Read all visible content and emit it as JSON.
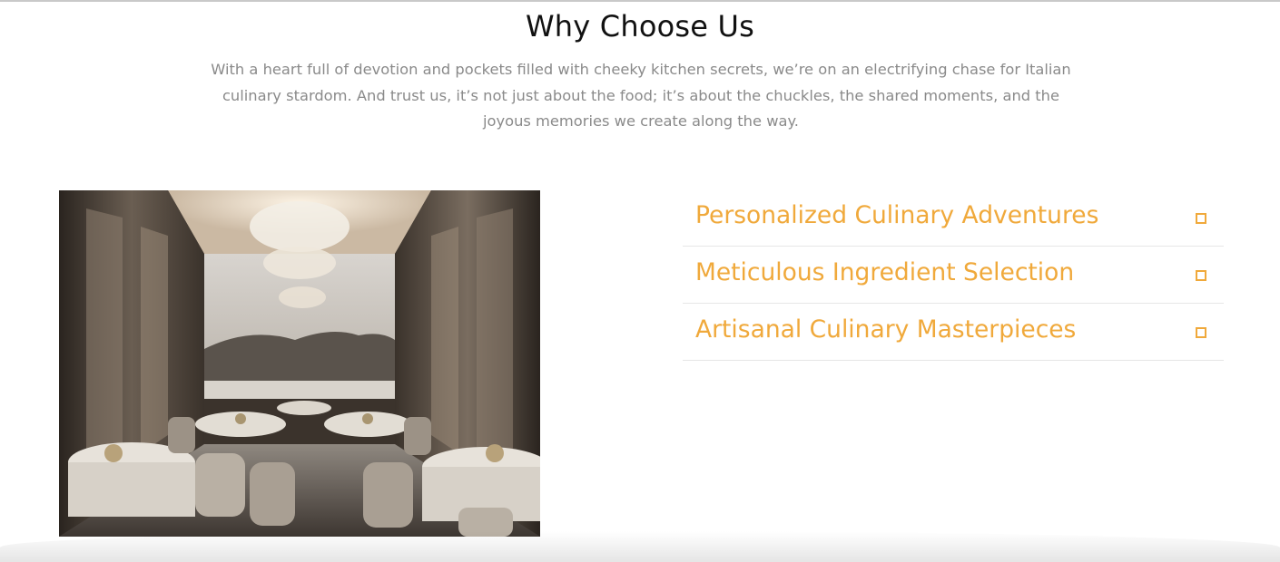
{
  "section": {
    "title": "Why Choose Us",
    "intro": "With a heart full of devotion and pockets filled with cheeky kitchen secrets, we’re on an electrifying chase for Italian culinary stardom. And trust us, it’s not just about the food; it’s about the chuckles, the shared moments, and the joyous memories we create along the way."
  },
  "accordion": {
    "items": [
      {
        "title": "Personalized Culinary Adventures",
        "icon": "square-toggle-icon"
      },
      {
        "title": "Meticulous Ingredient Selection",
        "icon": "square-toggle-icon"
      },
      {
        "title": "Artisanal Culinary Masterpieces",
        "icon": "square-toggle-icon"
      }
    ]
  },
  "colors": {
    "accent": "#f0a93b",
    "heading": "#111111",
    "body_text": "#8a8a8a",
    "divider": "#e6e6e6"
  }
}
